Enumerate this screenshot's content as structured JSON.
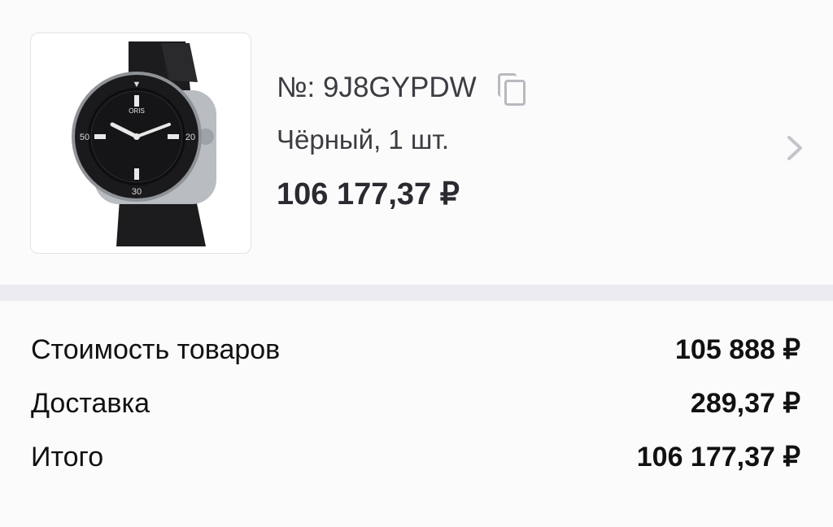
{
  "product": {
    "image_alt_icon": "watch-product-image",
    "order_label": "№: 9J8GYPDW",
    "variant": "Чёрный, 1 шт.",
    "price": "106 177,37 ₽"
  },
  "summary": {
    "rows": [
      {
        "label": "Стоимость товаров",
        "value": "105 888 ₽"
      },
      {
        "label": "Доставка",
        "value": "289,37 ₽"
      },
      {
        "label": "Итого",
        "value": "106 177,37 ₽"
      }
    ]
  },
  "colors": {
    "background": "#f6f6f8",
    "card": "#fbfbfc",
    "text_primary": "#111111",
    "text_secondary": "#3c3c42",
    "icon_gray": "#b8b8bf"
  },
  "icons": [
    "copy-icon",
    "chevron-right-icon"
  ]
}
